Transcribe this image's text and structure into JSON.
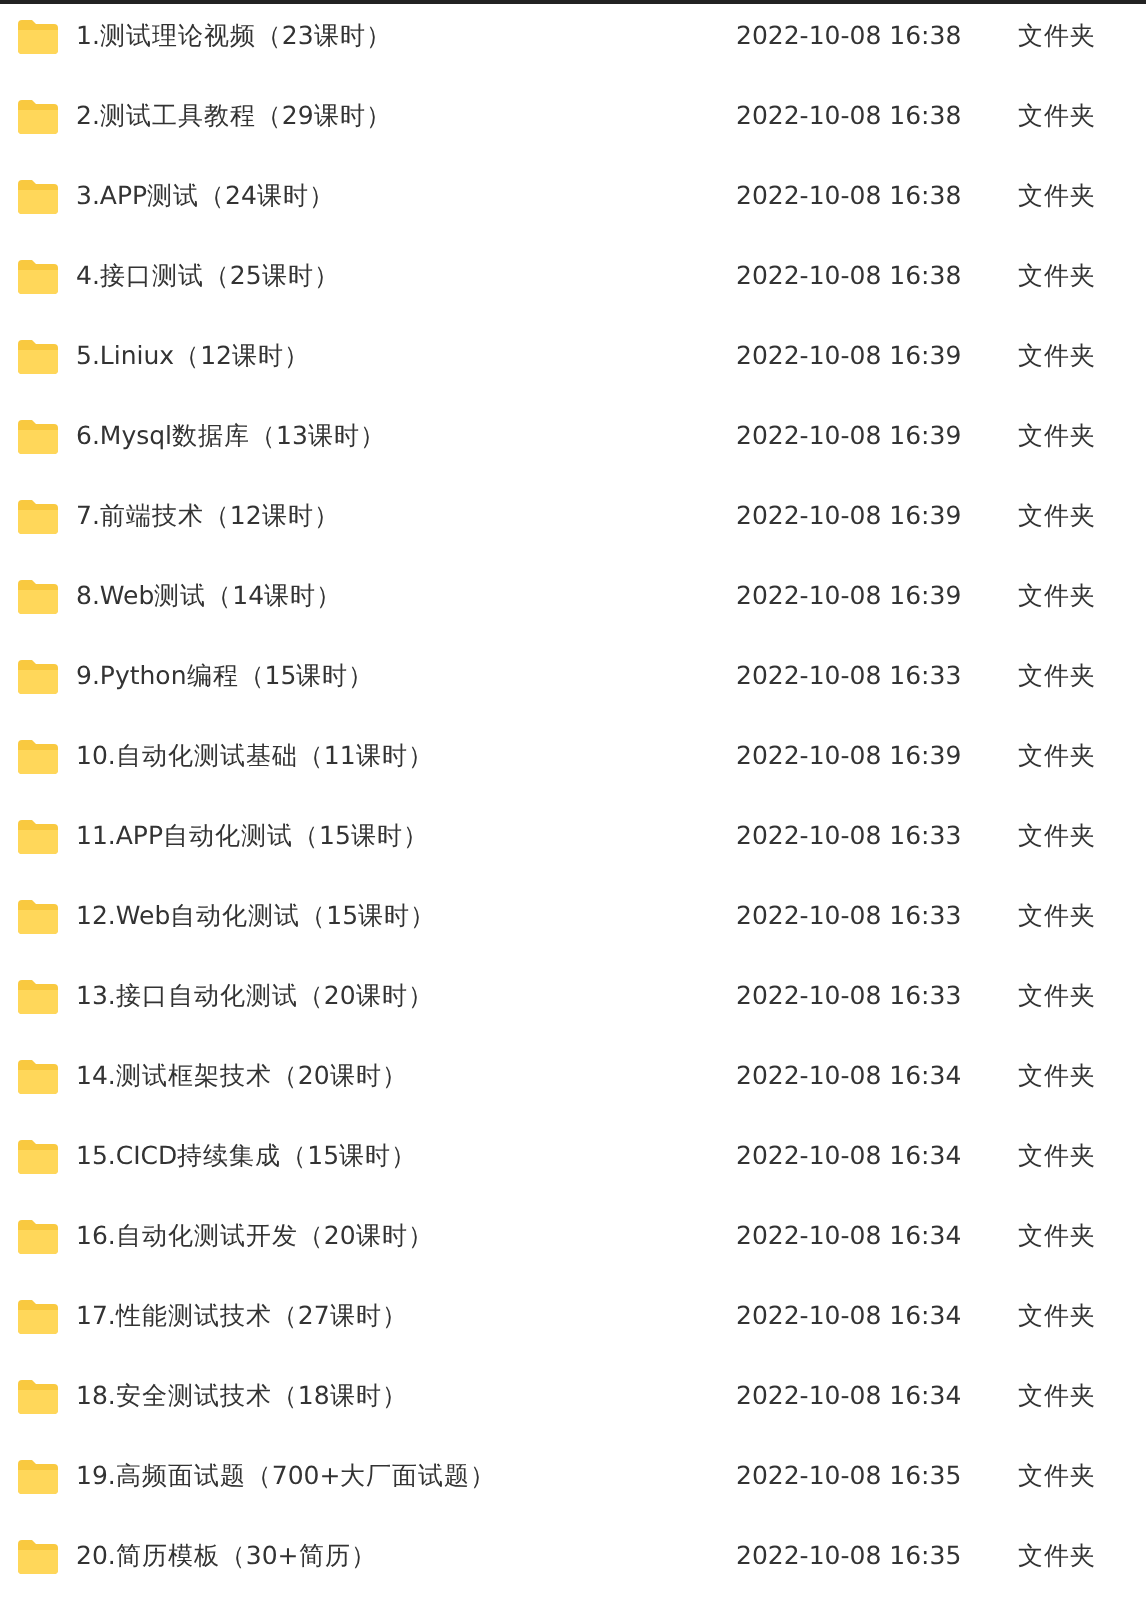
{
  "files": [
    {
      "name": "1.测试理论视频（23课时）",
      "modified": "2022-10-08 16:38",
      "type": "文件夹"
    },
    {
      "name": "2.测试工具教程（29课时）",
      "modified": "2022-10-08 16:38",
      "type": "文件夹"
    },
    {
      "name": "3.APP测试（24课时）",
      "modified": "2022-10-08 16:38",
      "type": "文件夹"
    },
    {
      "name": "4.接口测试（25课时）",
      "modified": "2022-10-08 16:38",
      "type": "文件夹"
    },
    {
      "name": "5.Liniux（12课时）",
      "modified": "2022-10-08 16:39",
      "type": "文件夹"
    },
    {
      "name": "6.Mysql数据库（13课时）",
      "modified": "2022-10-08 16:39",
      "type": "文件夹"
    },
    {
      "name": "7.前端技术（12课时）",
      "modified": "2022-10-08 16:39",
      "type": "文件夹"
    },
    {
      "name": "8.Web测试（14课时）",
      "modified": "2022-10-08 16:39",
      "type": "文件夹"
    },
    {
      "name": "9.Python编程（15课时）",
      "modified": "2022-10-08 16:33",
      "type": "文件夹"
    },
    {
      "name": "10.自动化测试基础（11课时）",
      "modified": "2022-10-08 16:39",
      "type": "文件夹"
    },
    {
      "name": "11.APP自动化测试（15课时）",
      "modified": "2022-10-08 16:33",
      "type": "文件夹"
    },
    {
      "name": "12.Web自动化测试（15课时）",
      "modified": "2022-10-08 16:33",
      "type": "文件夹"
    },
    {
      "name": "13.接口自动化测试（20课时）",
      "modified": "2022-10-08 16:33",
      "type": "文件夹"
    },
    {
      "name": "14.测试框架技术（20课时）",
      "modified": "2022-10-08 16:34",
      "type": "文件夹"
    },
    {
      "name": "15.CICD持续集成（15课时）",
      "modified": "2022-10-08 16:34",
      "type": "文件夹"
    },
    {
      "name": "16.自动化测试开发（20课时）",
      "modified": "2022-10-08 16:34",
      "type": "文件夹"
    },
    {
      "name": "17.性能测试技术（27课时）",
      "modified": "2022-10-08 16:34",
      "type": "文件夹"
    },
    {
      "name": "18.安全测试技术（18课时）",
      "modified": "2022-10-08 16:34",
      "type": "文件夹"
    },
    {
      "name": "19.高频面试题（700+大厂面试题）",
      "modified": "2022-10-08 16:35",
      "type": "文件夹"
    },
    {
      "name": "20.简历模板（30+简历）",
      "modified": "2022-10-08 16:35",
      "type": "文件夹"
    }
  ]
}
